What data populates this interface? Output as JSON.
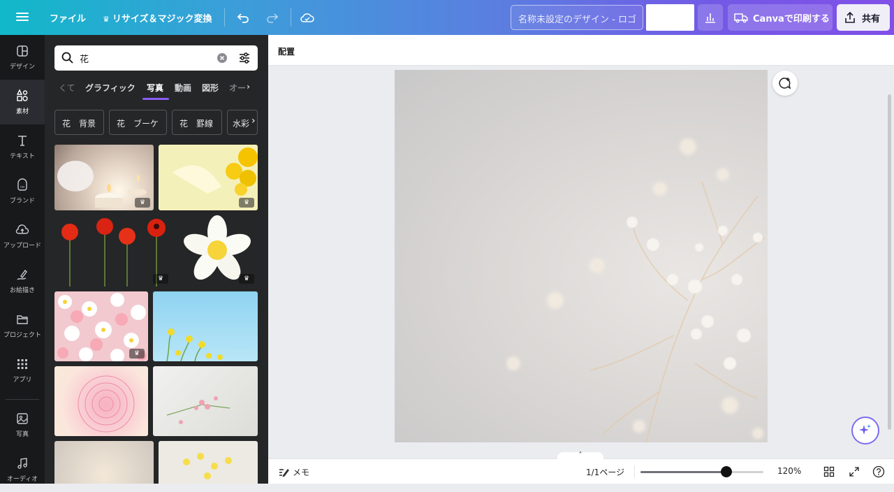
{
  "topbar": {
    "file_label": "ファイル",
    "resize_label": "リサイズ＆マジック変換",
    "title_placeholder": "名称未設定のデザイン - ロゴ",
    "print_label": "Canvaで印刷する",
    "share_label": "共有"
  },
  "rail": {
    "items": [
      {
        "label": "デザイン",
        "icon": "layout-icon"
      },
      {
        "label": "素材",
        "icon": "elements-icon"
      },
      {
        "label": "テキスト",
        "icon": "text-icon"
      },
      {
        "label": "ブランド",
        "icon": "brand-icon"
      },
      {
        "label": "アップロード",
        "icon": "upload-icon"
      },
      {
        "label": "お絵描き",
        "icon": "draw-icon"
      },
      {
        "label": "プロジェクト",
        "icon": "folder-icon"
      },
      {
        "label": "アプリ",
        "icon": "apps-icon"
      },
      {
        "label": "写真",
        "icon": "photo-icon"
      },
      {
        "label": "オーディオ",
        "icon": "audio-icon"
      }
    ]
  },
  "panel": {
    "search_value": "花",
    "tabs": [
      "グラフィック",
      "写真",
      "動画",
      "図形",
      "オー"
    ],
    "tab_prev": "くて",
    "chips": [
      "花　背景",
      "花　ブーケ",
      "花　罫線",
      "水彩"
    ]
  },
  "canvas": {
    "context_label": "配置"
  },
  "bottom": {
    "notes_label": "メモ",
    "page_indicator": "1/1ページ",
    "zoom_level": "120%",
    "zoom_fraction": 0.7
  },
  "colors": {
    "accent": "#8b5cf6",
    "panel_bg": "#252627",
    "rail_bg": "#18191b"
  }
}
